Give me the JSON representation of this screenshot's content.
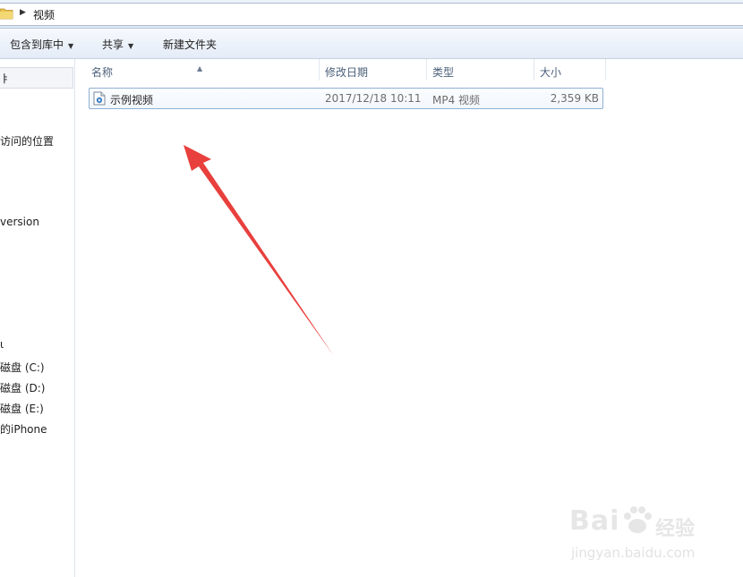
{
  "address": {
    "crumb": "视频"
  },
  "toolbar": {
    "include_library": "包含到库中",
    "share": "共享",
    "new_folder": "新建文件夹"
  },
  "nav": {
    "top_partial": "ㅑ",
    "items": [
      "访问的位置",
      "version",
      "ι",
      "磁盘 (C:)",
      "磁盘 (D:)",
      "磁盘 (E:)",
      "的iPhone"
    ]
  },
  "columns": {
    "name": "名称",
    "date": "修改日期",
    "type": "类型",
    "size": "大小"
  },
  "files": [
    {
      "name": "示例视频",
      "date": "2017/12/18 10:11",
      "type": "MP4 视频",
      "size": "2,359 KB"
    }
  ],
  "watermark": {
    "brand": "Bai",
    "cn": "经验",
    "url": "jingyan.baidu.com"
  },
  "colors": {
    "accent": "#3a6ea5",
    "annotation_arrow": "#e8403d"
  }
}
